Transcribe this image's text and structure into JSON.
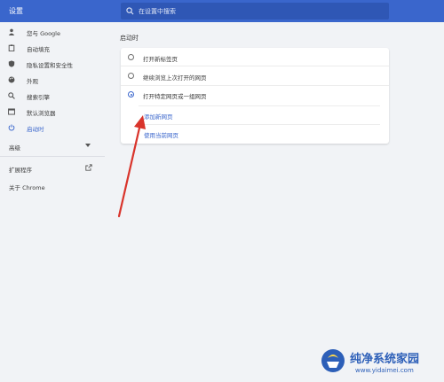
{
  "app": {
    "title": "设置"
  },
  "search": {
    "placeholder": "在设置中搜索"
  },
  "sidebar": {
    "items": [
      {
        "label": "您与 Google",
        "icon": "person-icon"
      },
      {
        "label": "自动填充",
        "icon": "clipboard-icon"
      },
      {
        "label": "隐私设置和安全性",
        "icon": "shield-icon"
      },
      {
        "label": "外观",
        "icon": "palette-icon"
      },
      {
        "label": "搜索引擎",
        "icon": "search-icon"
      },
      {
        "label": "默认浏览器",
        "icon": "browser-icon"
      },
      {
        "label": "启动时",
        "icon": "power-icon",
        "active": true
      }
    ],
    "advanced": "高级",
    "extensions": "扩展程序",
    "about": "关于 Chrome"
  },
  "main": {
    "section_title": "启动时",
    "options": [
      {
        "label": "打开新标签页",
        "checked": false
      },
      {
        "label": "继续浏览上次打开的网页",
        "checked": false
      },
      {
        "label": "打开特定网页或一组网页",
        "checked": true
      }
    ],
    "add_page_link": "添加新网页",
    "use_current_link": "使用当前网页"
  },
  "watermark": {
    "title": "纯净系统家园",
    "url": "www.yidaimei.com"
  },
  "colors": {
    "accent": "#3a66cc",
    "topbar": "#3a66cc",
    "arrow": "#d9342b"
  }
}
